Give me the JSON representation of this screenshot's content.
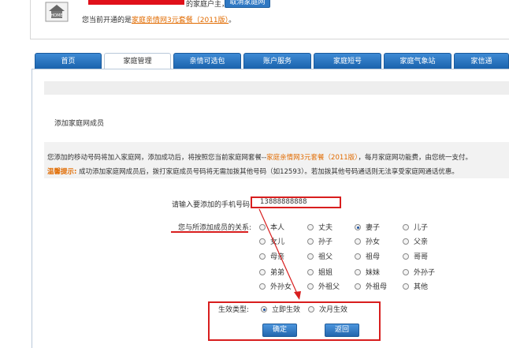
{
  "header": {
    "welcome_text": "的家庭户主，欢迎回家！",
    "cancel_button": "取消家庭网",
    "plan_prefix": "您当前开通的是",
    "plan_link": "家庭亲情网3元套餐（2011版）",
    "plan_suffix": "。"
  },
  "tabs": [
    "首页",
    "家庭管理",
    "亲情可选包",
    "账户服务",
    "家庭短号",
    "家庭气象站",
    "家信通"
  ],
  "section": {
    "title": "添加家庭网成员"
  },
  "info": {
    "line1_a": "您添加的移动号码将加入家庭网，添加成功后，将按照您当前家庭网套餐--",
    "line1_link": "家庭亲情网3元套餐（2011版）",
    "line1_b": "，每月家庭网功能费，由您统一支付。",
    "tip_label": "温馨提示:",
    "line2": " 成功添加家庭网成员后，拨打家庭成员号码将无需加拨其他号码（如12593）。若加拨其他号码通话则无法享受家庭网通话优惠。"
  },
  "form": {
    "phone_label": "请输入要添加的手机号码:",
    "phone_value": "13888888888",
    "relation_label": "您与所添加成员的关系:",
    "relations": [
      "本人",
      "丈夫",
      "妻子",
      "儿子",
      "女儿",
      "孙子",
      "孙女",
      "父亲",
      "母亲",
      "祖父",
      "祖母",
      "哥哥",
      "弟弟",
      "姐姐",
      "妹妹",
      "外孙子",
      "外孙女",
      "外祖父",
      "外祖母",
      "其他"
    ],
    "selected_relation": "妻子",
    "effect_label": "生效类型:",
    "effect_options": [
      "立即生效",
      "次月生效"
    ],
    "selected_effect": "立即生效",
    "confirm_button": "确定",
    "back_button": "返回"
  },
  "colors": {
    "tab_blue": "#2f78c3",
    "highlight_orange": "#e16b00",
    "annotation_red": "#d81e1e"
  }
}
